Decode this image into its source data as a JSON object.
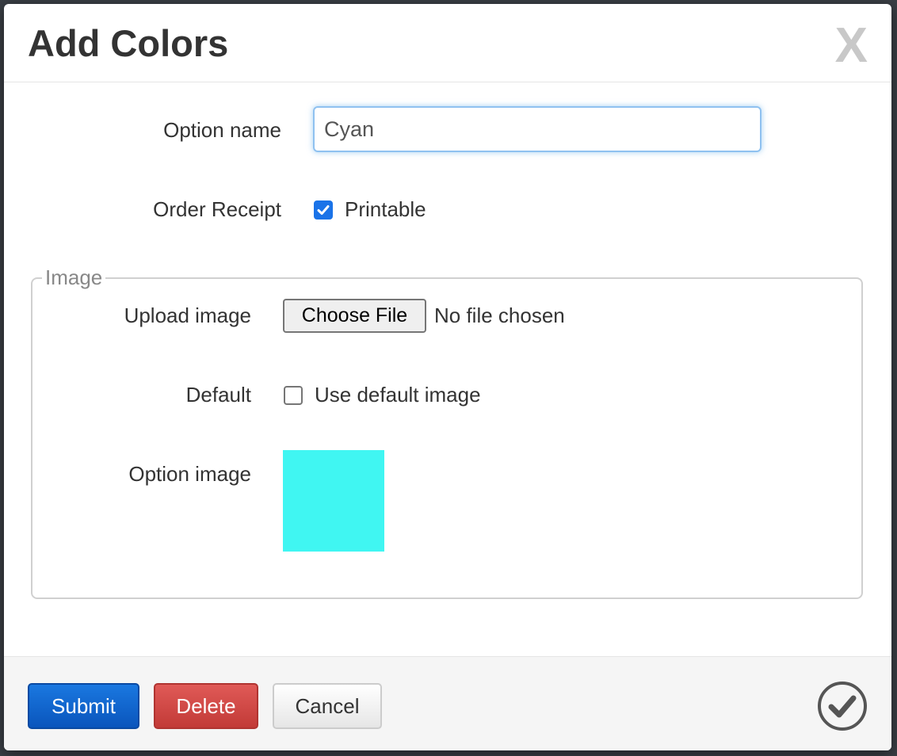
{
  "modal": {
    "title": "Add Colors",
    "close_label": "X"
  },
  "form": {
    "option_name_label": "Option name",
    "option_name_value": "Cyan",
    "order_receipt_label": "Order Receipt",
    "printable_label": "Printable",
    "printable_checked": true
  },
  "image_section": {
    "legend": "Image",
    "upload_label": "Upload image",
    "choose_file_label": "Choose File",
    "no_file_text": "No file chosen",
    "default_label": "Default",
    "use_default_label": "Use default image",
    "use_default_checked": false,
    "option_image_label": "Option image",
    "swatch_color": "#40f6f2"
  },
  "footer": {
    "submit_label": "Submit",
    "delete_label": "Delete",
    "cancel_label": "Cancel"
  },
  "icons": {
    "close": "close-icon",
    "checkmark": "checkmark-icon",
    "confirm": "check-circle-icon"
  }
}
